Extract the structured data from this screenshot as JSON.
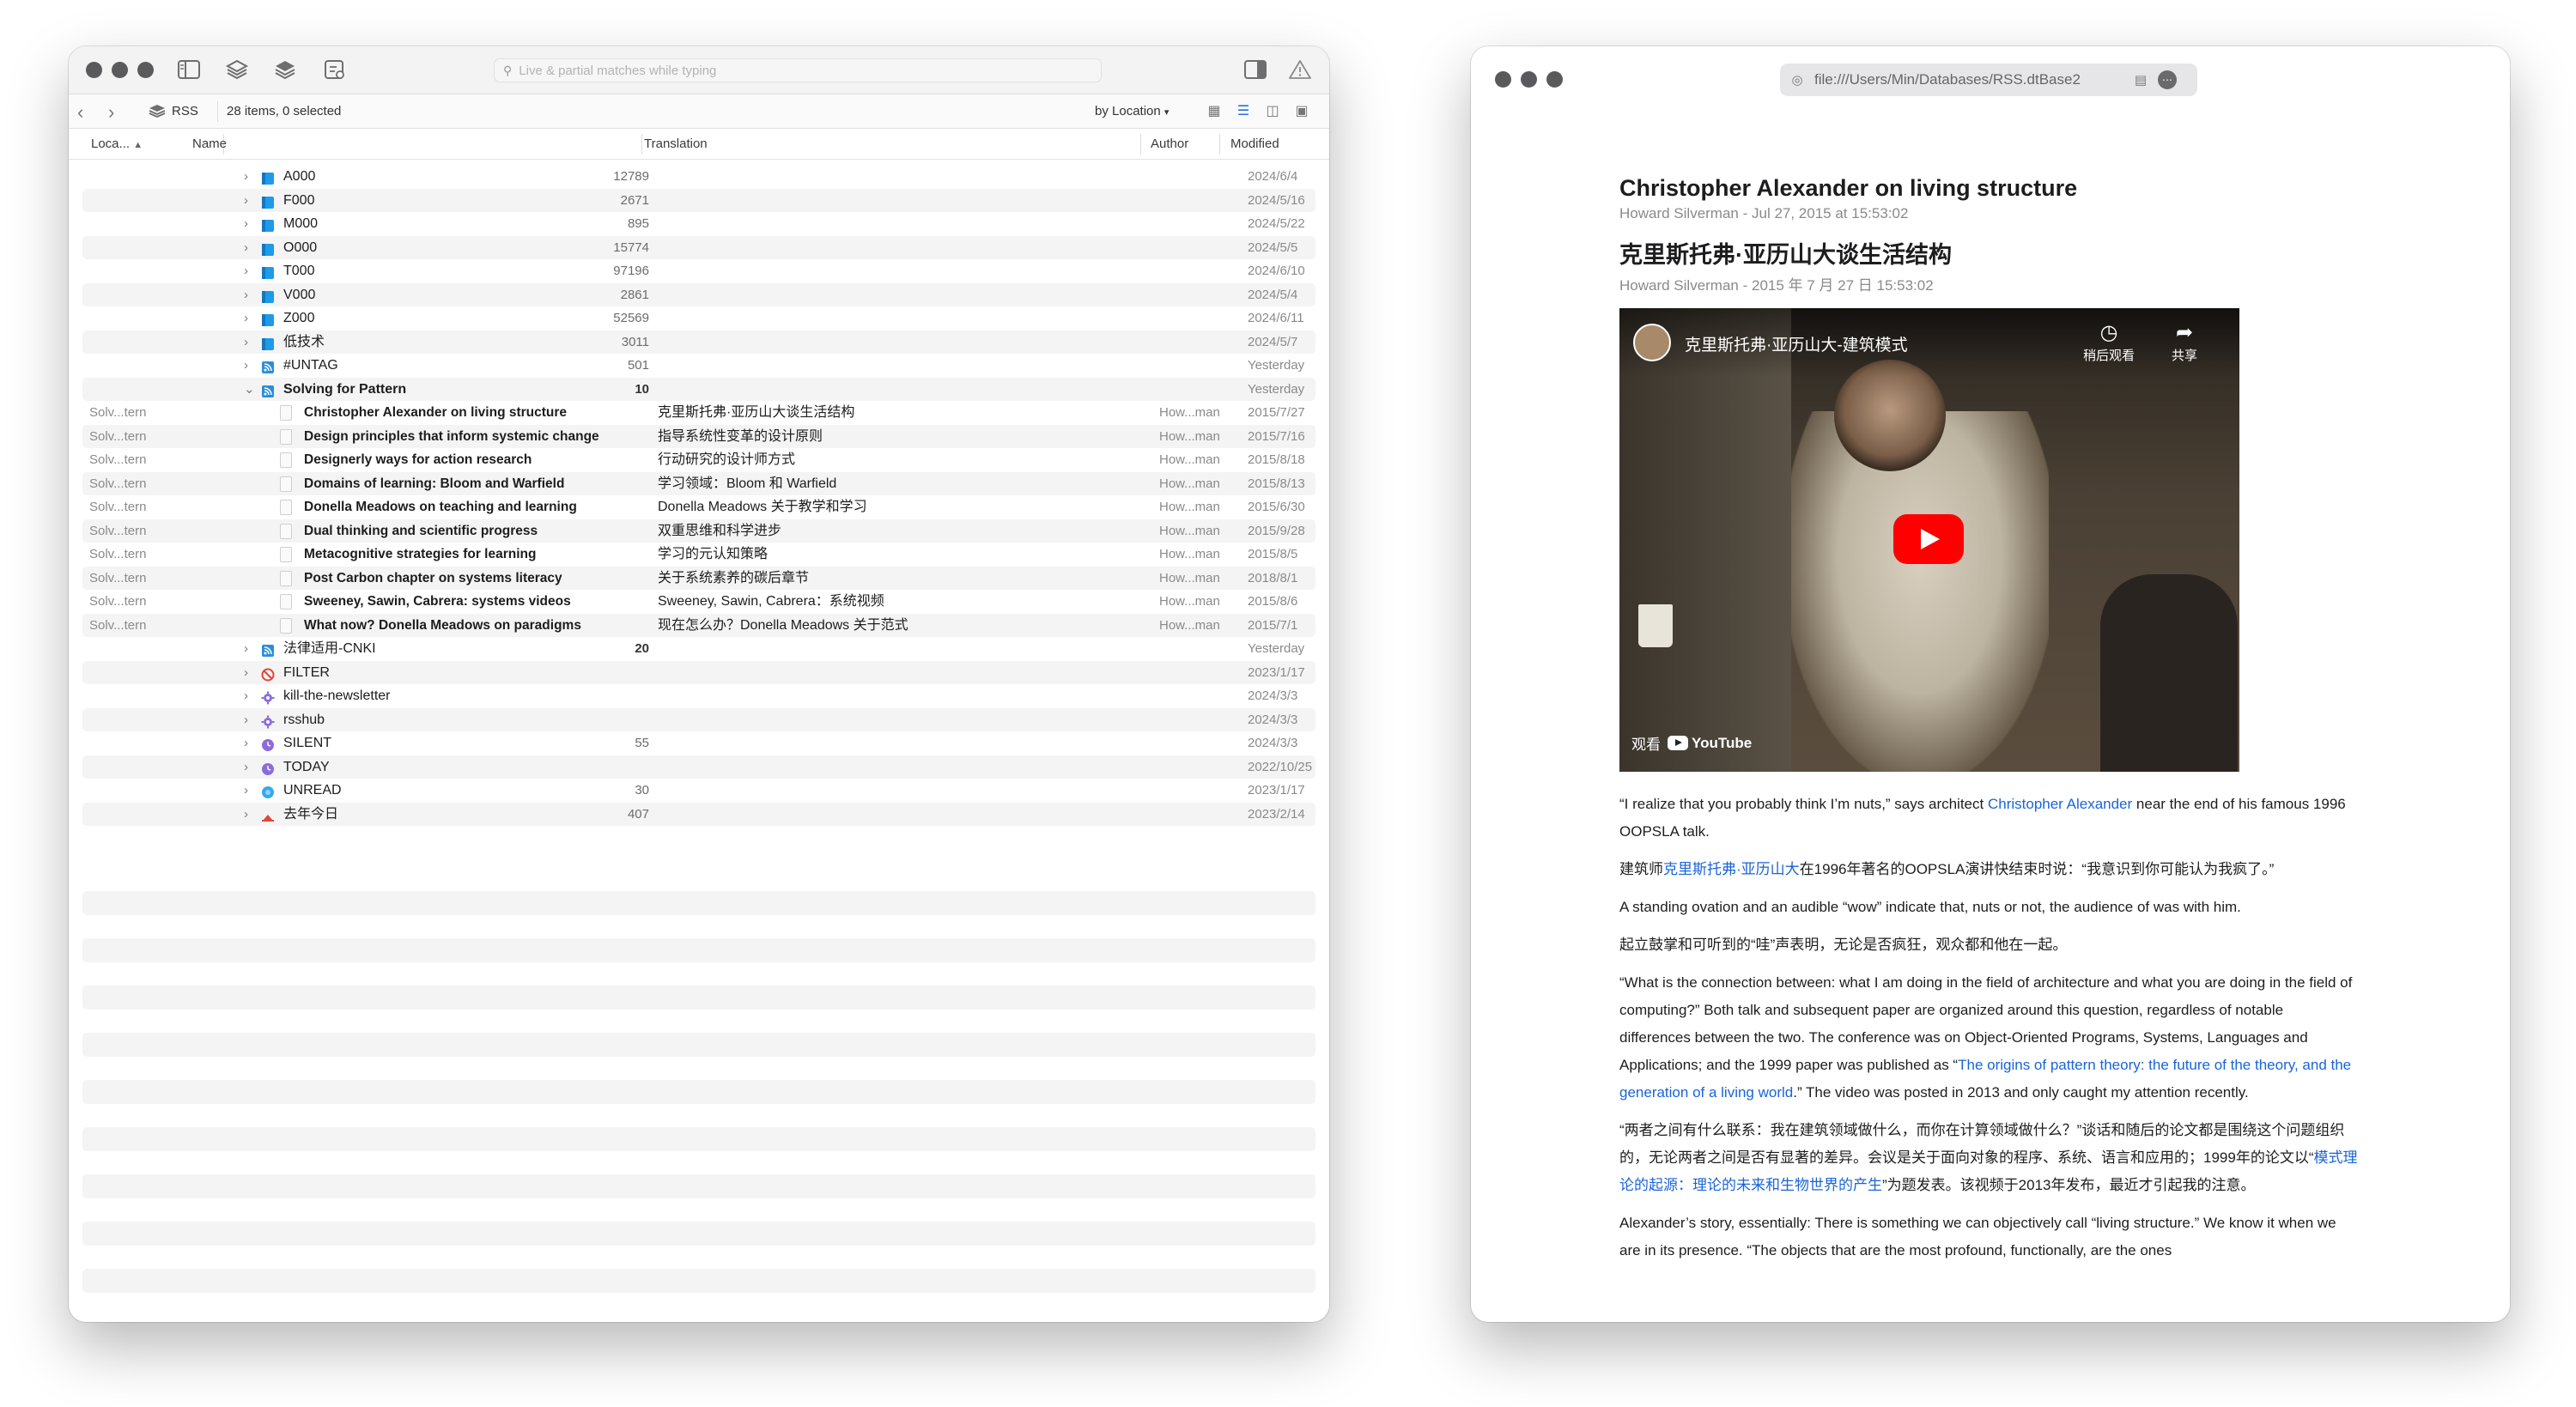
{
  "left_window": {
    "search_placeholder": "Live & partial matches while typing",
    "breadcrumb": "RSS",
    "item_count": "28 items, 0 selected",
    "sort_label": "by Location",
    "columns": {
      "location": "Loca...",
      "name": "Name",
      "translation": "Translation",
      "author": "Author",
      "modified": "Modified"
    },
    "groups": [
      {
        "name": "A000",
        "count": "12789",
        "modified": "2024/6/4",
        "icon": "folder-blue"
      },
      {
        "name": "F000",
        "count": "2671",
        "modified": "2024/5/16",
        "icon": "folder-blue"
      },
      {
        "name": "M000",
        "count": "895",
        "modified": "2024/5/22",
        "icon": "folder-blue"
      },
      {
        "name": "O000",
        "count": "15774",
        "modified": "2024/5/5",
        "icon": "folder-blue"
      },
      {
        "name": "T000",
        "count": "97196",
        "modified": "2024/6/10",
        "icon": "folder-blue"
      },
      {
        "name": "V000",
        "count": "2861",
        "modified": "2024/5/4",
        "icon": "folder-blue"
      },
      {
        "name": "Z000",
        "count": "52569",
        "modified": "2024/6/11",
        "icon": "folder-blue"
      },
      {
        "name": "低技术",
        "count": "3011",
        "modified": "2024/5/7",
        "icon": "folder-blue"
      },
      {
        "name": "#UNTAG",
        "count": "501",
        "modified": "Yesterday",
        "icon": "feed"
      },
      {
        "name": "Solving for Pattern",
        "count": "10",
        "modified": "Yesterday",
        "icon": "feed",
        "expanded": true
      }
    ],
    "children": [
      {
        "loc": "Solv...tern",
        "name": "Christopher Alexander on living structure",
        "translation": "克里斯托弗·亚历山大谈生活结构",
        "author": "How...man",
        "modified": "2015/7/27"
      },
      {
        "loc": "Solv...tern",
        "name": "Design principles that inform systemic change",
        "translation": "指导系统性变革的设计原则",
        "author": "How...man",
        "modified": "2015/7/16"
      },
      {
        "loc": "Solv...tern",
        "name": "Designerly ways for action research",
        "translation": "行动研究的设计师方式",
        "author": "How...man",
        "modified": "2015/8/18"
      },
      {
        "loc": "Solv...tern",
        "name": "Domains of learning: Bloom and Warfield",
        "translation": "学习领域：Bloom 和 Warfield",
        "author": "How...man",
        "modified": "2015/8/13"
      },
      {
        "loc": "Solv...tern",
        "name": "Donella Meadows on teaching and learning",
        "translation": "Donella Meadows 关于教学和学习",
        "author": "How...man",
        "modified": "2015/6/30"
      },
      {
        "loc": "Solv...tern",
        "name": "Dual thinking and scientific progress",
        "translation": "双重思维和科学进步",
        "author": "How...man",
        "modified": "2015/9/28"
      },
      {
        "loc": "Solv...tern",
        "name": "Metacognitive strategies for learning",
        "translation": "学习的元认知策略",
        "author": "How...man",
        "modified": "2015/8/5"
      },
      {
        "loc": "Solv...tern",
        "name": "Post Carbon chapter on systems literacy",
        "translation": "关于系统素养的碳后章节",
        "author": "How...man",
        "modified": "2018/8/1"
      },
      {
        "loc": "Solv...tern",
        "name": "Sweeney, Sawin, Cabrera: systems videos",
        "translation": "Sweeney, Sawin, Cabrera：系统视频",
        "author": "How...man",
        "modified": "2015/8/6"
      },
      {
        "loc": "Solv...tern",
        "name": "What now? Donella Meadows on paradigms",
        "translation": "现在怎么办？Donella Meadows 关于范式",
        "author": "How...man",
        "modified": "2015/7/1"
      }
    ],
    "groups_after": [
      {
        "name": "法律适用-CNKI",
        "count": "20",
        "modified": "Yesterday",
        "icon": "feed",
        "bold_count": true
      },
      {
        "name": "FILTER",
        "count": "",
        "modified": "2023/1/17",
        "icon": "no-entry"
      },
      {
        "name": "kill-the-newsletter",
        "count": "",
        "modified": "2024/3/3",
        "icon": "gear"
      },
      {
        "name": "rsshub",
        "count": "",
        "modified": "2024/3/3",
        "icon": "gear"
      },
      {
        "name": "SILENT",
        "count": "55",
        "modified": "2024/3/3",
        "icon": "clock-purple"
      },
      {
        "name": "TODAY",
        "count": "",
        "modified": "2022/10/25",
        "icon": "clock-purple"
      },
      {
        "name": "UNREAD",
        "count": "30",
        "modified": "2023/1/17",
        "icon": "dot-blue"
      },
      {
        "name": "去年今日",
        "count": "407",
        "modified": "2023/2/14",
        "icon": "hat-red"
      }
    ]
  },
  "right_window": {
    "url": "file:///Users/Min/Databases/RSS.dtBase2",
    "title_en": "Christopher Alexander on living structure",
    "meta_en": "Howard Silverman - Jul 27, 2015 at 15:53:02",
    "title_zh": "克里斯托弗·亚历山大谈生活结构",
    "meta_zh": "Howard Silverman - 2015 年 7 月 27 日 15:53:02",
    "video": {
      "title": "克里斯托弗·亚历山大-建筑模式",
      "watch_later": "稍后观看",
      "share": "共享",
      "watch_on": "观看",
      "youtube": "YouTube"
    },
    "p1_a": "“I realize that you probably think I’m nuts,” says architect ",
    "p1_link": "Christopher Alexander",
    "p1_b": " near the end of his famous 1996 OOPSLA talk.",
    "p2_a": "建筑师",
    "p2_link": "克里斯托弗·亚历山大",
    "p2_b": "在1996年著名的OOPSLA演讲快结束时说：“我意识到你可能认为我疯了。”",
    "p3": "A standing ovation and an audible “wow” indicate that, nuts or not, the audience of was with him.",
    "p4": "起立鼓掌和可听到的“哇”声表明，无论是否疯狂，观众都和他在一起。",
    "p5_a": "“What is the connection between: what I am doing in the field of architecture and what you are doing in the field of computing?” Both talk and subsequent paper are organized around this question, regardless of notable differences between the two. The conference was on Object-Oriented Programs, Systems, Languages and Applications; and the 1999 paper was published as “",
    "p5_link": "The origins of pattern theory: the future of the theory, and the generation of a living world",
    "p5_b": ".” The video was posted in 2013 and only caught my attention recently.",
    "p6_a": "“两者之间有什么联系：我在建筑领域做什么，而你在计算领域做什么？”谈话和随后的论文都是围绕这个问题组织的，无论两者之间是否有显著的差异。会议是关于面向对象的程序、系统、语言和应用的；1999年的论文以“",
    "p6_link": "模式理论的起源：理论的未来和生物世界的产生",
    "p6_b": "”为题发表。该视频于2013年发布，最近才引起我的注意。",
    "p7": "Alexander’s story, essentially: There is something we can objectively call “living structure.” We know it when we are in its presence. “The objects that are the most profound, functionally, are the ones"
  },
  "colors": {
    "folder": "#1e9be6",
    "link": "#1a64d8",
    "feed": "#2a8fd8",
    "filter": "#e0453a",
    "smart": "#8a6cdc"
  }
}
